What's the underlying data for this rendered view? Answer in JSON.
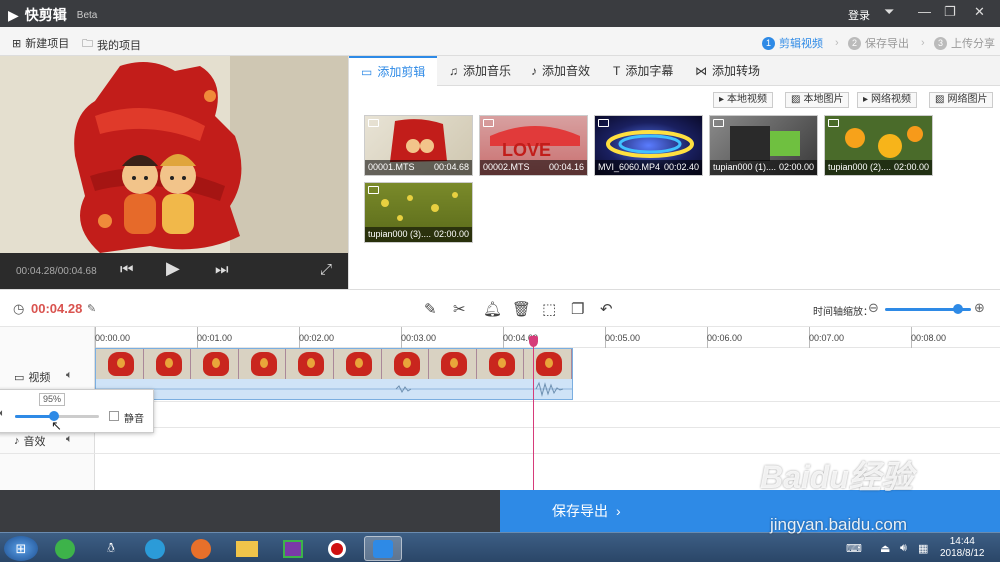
{
  "titlebar": {
    "app_name": "快剪辑",
    "beta": "Beta",
    "login": "登录"
  },
  "menubar": {
    "new_project": "新建项目",
    "my_projects": "我的项目"
  },
  "steps": [
    {
      "num": "1",
      "label": "剪辑视频"
    },
    {
      "num": "2",
      "label": "保存导出"
    },
    {
      "num": "3",
      "label": "上传分享"
    }
  ],
  "preview": {
    "time": "00:04.28/00:04.68"
  },
  "tabs": [
    {
      "label": "添加剪辑"
    },
    {
      "label": "添加音乐"
    },
    {
      "label": "添加音效"
    },
    {
      "label": "添加字幕"
    },
    {
      "label": "添加转场"
    }
  ],
  "source_buttons": [
    "本地视频",
    "本地图片",
    "网络视频",
    "网络图片"
  ],
  "media": [
    {
      "name": "00001.MTS",
      "duration": "00:04.68"
    },
    {
      "name": "00002.MTS",
      "duration": "00:04.16"
    },
    {
      "name": "MVI_6060.MP4",
      "duration": "00:02.40"
    },
    {
      "name": "tupian000 (1)....",
      "duration": "02:00.00"
    },
    {
      "name": "tupian000 (2)....",
      "duration": "02:00.00"
    },
    {
      "name": "tupian000 (3)....",
      "duration": "02:00.00"
    }
  ],
  "thumb_text": {
    "love": "LOVE"
  },
  "toolbar": {
    "current_time": "00:04.28",
    "zoom_label": "时间轴缩放："
  },
  "ruler": [
    "00:00.00",
    "00:01.00",
    "00:02.00",
    "00:03.00",
    "00:04.00",
    "00:05.00",
    "00:06.00",
    "00:07.00",
    "00:08.00"
  ],
  "tracks": {
    "video": "视频",
    "sfx": "音效"
  },
  "volume": {
    "value": "95%",
    "mute": "静音",
    "level": 0.95
  },
  "export": {
    "label": "保存导出"
  },
  "clock": {
    "time": "14:44",
    "date": "2018/8/12"
  },
  "watermark": {
    "logo": "Baidu经验",
    "url": "jingyan.baidu.com"
  }
}
